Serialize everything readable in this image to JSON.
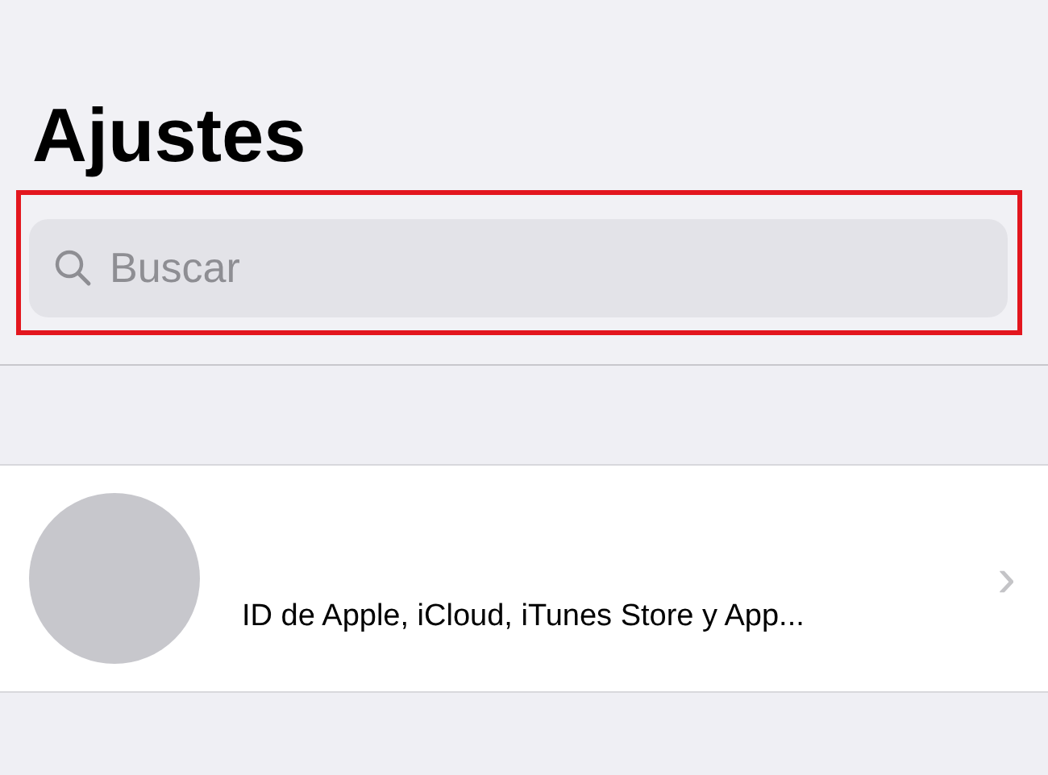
{
  "title": "Ajustes",
  "search": {
    "placeholder": "Buscar",
    "highlighted": true
  },
  "account": {
    "subtitle": "ID de Apple, iCloud, iTunes Store y App...",
    "chevron": "›"
  }
}
